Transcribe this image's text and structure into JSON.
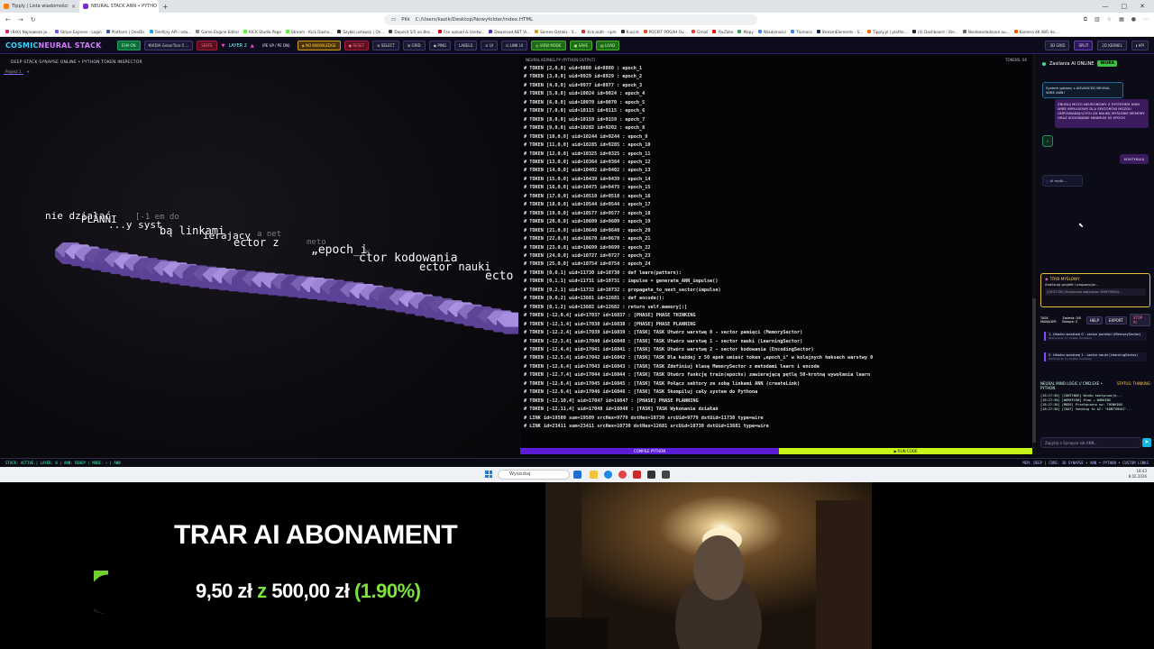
{
  "browser": {
    "tabs": [
      {
        "label": "Tipply | Lista wiadomości",
        "active": false
      },
      {
        "label": "NEURAL STACK ANN • PYTHO",
        "active": true
      }
    ],
    "new_tab": "+",
    "url_prefix": "Plik",
    "url": "C:/Users/kazik/Desktop/Nowyfolder/index.HTML",
    "bookmarks": [
      {
        "label": "(940) Najnowsze je...",
        "color": "#e0245e"
      },
      {
        "label": "Stripe Express - Login",
        "color": "#635bff"
      },
      {
        "label": "Platform | OneDis",
        "color": "#3b5998"
      },
      {
        "label": "Telefijny API i odu...",
        "color": "#1da1f2"
      },
      {
        "label": "Game Engine Editor",
        "color": "#888888"
      },
      {
        "label": "KICK Studio Page",
        "color": "#53fc18"
      },
      {
        "label": "Stream - Kick Dasho...",
        "color": "#53fc18"
      },
      {
        "label": "Szybki ustawcji | On...",
        "color": "#333333"
      },
      {
        "label": "Deposit 5/5 on Bec...",
        "color": "#444444"
      },
      {
        "label": "Fan upload & Usetw...",
        "color": "#d0021b"
      },
      {
        "label": "Download.NET Vi...",
        "color": "#512bd4"
      },
      {
        "label": "Serene Details - S...",
        "color": "#c9a227"
      },
      {
        "label": "tick-auth - npm",
        "color": "#cb3837"
      },
      {
        "label": "K-acint",
        "color": "#333333"
      },
      {
        "label": "POCKIT POGAH Ov...",
        "color": "#e94e1b"
      },
      {
        "label": "Gmail",
        "color": "#ea4335"
      },
      {
        "label": "YouTube",
        "color": "#ff0000"
      },
      {
        "label": "Mapy",
        "color": "#34a853"
      },
      {
        "label": "Wiadomości",
        "color": "#4285f4"
      },
      {
        "label": "Tłumacz",
        "color": "#4285f4"
      },
      {
        "label": "StreamElements - S...",
        "color": "#0f2c4c"
      },
      {
        "label": "Tipply.pl | platfor...",
        "color": "#ff6a00"
      },
      {
        "label": "(4) Dashboard - Ste...",
        "color": "#1b2838"
      },
      {
        "label": "Nienbandadzone au...",
        "color": "#666666"
      },
      {
        "label": "Kamera 4K WiFi do...",
        "color": "#ff5a00"
      }
    ]
  },
  "app": {
    "logo_part1": "COSMIC",
    "logo_part2": "NEURAL STACK",
    "header_buttons": [
      {
        "label": "ESM ON",
        "style": "g"
      },
      {
        "label": "NVIDIA GeaorTron-5 ...",
        "style": "d"
      },
      {
        "label": "SEKTE",
        "style": "r"
      }
    ],
    "layer_label": "LAYER 2",
    "layer_prev": "▼",
    "layer_next": "▲",
    "tool_buttons": [
      {
        "label": "(PE UP / PE DN)",
        "style": "t"
      },
      {
        "label": "◈ NO KNOWLEDGE",
        "style": "o"
      },
      {
        "label": "● RESET",
        "style": "r"
      },
      {
        "label": "⊕ SELECT",
        "style": "d"
      },
      {
        "label": "⊞ GRID",
        "style": "d"
      },
      {
        "label": "◉ PING",
        "style": "d"
      },
      {
        "label": "LABELS",
        "style": "d"
      },
      {
        "label": "⊘ UI",
        "style": "d"
      },
      {
        "label": "⊡ LINK UI",
        "style": "d"
      },
      {
        "label": "◎ VIEW MODE",
        "style": "grn"
      },
      {
        "label": "▣ SAVE",
        "style": "grn"
      },
      {
        "label": "▤ LOAD",
        "style": "grn"
      }
    ],
    "right_buttons": [
      {
        "label": "3D GRID",
        "style": "d"
      },
      {
        "label": "SPLIT",
        "style": "p"
      },
      {
        "label": "2D KERNEL",
        "style": "d"
      },
      {
        "label": "ℹ API",
        "style": "d"
      }
    ]
  },
  "left_pane": {
    "title": "DEEP STACK SYNAPSE ONLINE • PYTHON TOKEN INSPECTOR",
    "tab": "Project 1",
    "tab_add": "+",
    "floating_texts": [
      {
        "text": "nie działać",
        "color": "#ffffff"
      },
      {
        "text": "PLANNI",
        "color": "#ffffff"
      },
      {
        "text": "[-1 em do",
        "color": "#888888"
      },
      {
        "text": "...y syst",
        "color": "#ffffff"
      },
      {
        "text": "bą linkami",
        "color": "#ffffff"
      },
      {
        "text": "ierający",
        "color": "#ffffff"
      },
      {
        "text": "a net",
        "color": "#888888"
      },
      {
        "text": "ector z",
        "color": "#ffffff"
      },
      {
        "text": "meto",
        "color": "#777777"
      },
      {
        "text": "„epoch_i",
        "color": "#ffffff"
      },
      {
        "text": "w",
        "color": "#888888"
      },
      {
        "text": "ctor kodowania",
        "color": "#ffffff"
      },
      {
        "text": "ector nauki",
        "color": "#ffffff"
      },
      {
        "text": "ecto",
        "color": "#ffffff"
      }
    ]
  },
  "console": {
    "title": "NEURAL KERNEL.PY (PYTHON OUTPUT)",
    "count": "TOKENS: 66",
    "lines": [
      "# TOKEN [2,0,0] uid=9880 id=8880 : epoch_1",
      "# TOKEN [3,0,0] uid=9929 id=8929 : epoch_2",
      "# TOKEN [4,0,0] uid=9977 id=8977 : epoch_3",
      "# TOKEN [5,0,0] uid=10024 id=9024 : epoch_4",
      "# TOKEN [6,0,0] uid=10070 id=9070 : epoch_5",
      "# TOKEN [7,0,0] uid=10115 id=9115 : epoch_6",
      "# TOKEN [8,0,0] uid=10159 id=9159 : epoch_7",
      "# TOKEN [9,0,0] uid=10202 id=9202 : epoch_8",
      "# TOKEN [10,0,0] uid=10244 id=9244 : epoch_9",
      "# TOKEN [11,0,0] uid=10285 id=9285 : epoch_10",
      "# TOKEN [12,0,0] uid=10325 id=9325 : epoch_11",
      "# TOKEN [13,0,0] uid=10364 id=9364 : epoch_12",
      "# TOKEN [14,0,0] uid=10402 id=9402 : epoch_13",
      "# TOKEN [15,0,0] uid=10439 id=9439 : epoch_14",
      "# TOKEN [16,0,0] uid=10475 id=9475 : epoch_15",
      "# TOKEN [17,0,0] uid=10510 id=9510 : epoch_16",
      "# TOKEN [18,0,0] uid=10544 id=9544 : epoch_17",
      "# TOKEN [19,0,0] uid=10577 id=9577 : epoch_18",
      "# TOKEN [20,0,0] uid=10609 id=9609 : epoch_19",
      "# TOKEN [21,0,0] uid=10640 id=9640 : epoch_20",
      "# TOKEN [22,0,0] uid=10670 id=9670 : epoch_21",
      "# TOKEN [23,0,0] uid=10699 id=9699 : epoch_22",
      "# TOKEN [24,0,0] uid=10727 id=9727 : epoch_23",
      "# TOKEN [25,0,0] uid=10754 id=9754 : epoch_24",
      "# TOKEN [0,0,1] uid=11730 id=10730 : def learn(pattern):",
      "# TOKEN [0,1,1] uid=11731 id=10731 : impulse = generate_ANN_impulse()",
      "# TOKEN [0,2,1] uid=11732 id=10732 : propagate_to_next_sector(impulse)",
      "# TOKEN [0,0,2] uid=13681 id=12681 : def encode():",
      "# TOKEN [0,1,2] uid=13682 id=12682 : return self.memory[:]",
      "# TOKEN [-12,0,4] uid=17037 id=16037 : [PHASE] PHASE THINKING",
      "# TOKEN [-12,1,4] uid=17038 id=16038 : [PHASE] PHASE PLANNING",
      "# TOKEN [-12,2,4] uid=17039 id=16039 : [TASK] TASK Utwórz warstwę 0 - sector pamięci (MemorySector)",
      "# TOKEN [-12,3,4] uid=17040 id=16040 : [TASK] TASK Utwórz warstwę 1 - sector nauki (LearningSector)",
      "# TOKEN [-12,4,4] uid=17041 id=16041 : [TASK] TASK Utwórz warstwę 2 - sector kodowania (EncodingSector)",
      "# TOKEN [-12,5,4] uid=17042 id=16042 : [TASK] TASK Dla każdej z 50 epok umieść token „epoch_i\" w kolejnych heksach warstwy 0",
      "# TOKEN [-12,6,4] uid=17043 id=16043 : [TASK] TASK Zdefiniuj klasę MemorySector z metodami learn i encode",
      "# TOKEN [-12,7,4] uid=17044 id=16044 : [TASK] TASK Utwórz funkcję train(epochs) zawierającą pętlę 50-krotną wywołania learn",
      "# TOKEN [-12,8,4] uid=17045 id=16045 : [TASK] TASK Połącz sektory ze sobą linkami ANN (createLink)",
      "# TOKEN [-12,9,4] uid=17046 id=16046 : [TASK] TASK Skompiluj cały system do Pythona",
      "# TOKEN [-12,10,4] uid=17047 id=16047 : [PHASE] PHASE PLANNING",
      "# TOKEN [-12,11,4] uid=17048 id=16048 : [TASK] TASK Wykonanie działań",
      "# LINK id=19509 sum=19509 srcHex=9779 dstHex=10730 srcUid=9779 dstUid=11730 type=wire",
      "# LINK id=23411 sum=23411 srcHex=10730 dstHex=12681 srcUid=10730 dstUid=13681 type=wire"
    ],
    "compile_label": "COMPILE PYTHON",
    "run_label": "▶ RUN CODE"
  },
  "chat": {
    "title": "Zasilania AI ONLINE",
    "badge": "WORK",
    "bubble1": "System gotowy z ADVANCED NEURAL WIRE ANN!",
    "bubble2": "ZBUDUJ MÓZG NEURONOWY Z SYSTEMEM ANN! WIRE IMPULSOWY DLA SEKTORÓW MÓZGU ODPOWIADAJĄCYCH ZA NAUKĘ MYŚLENIE MEMORY ORAZ KODOWANIE MINIMUM 50 EPOCH",
    "check": "✓",
    "bubble3": "KONTYNUUJ",
    "thinking": "AI myśli...",
    "mode_title": "TRYB MYŚLOWY",
    "mode_subtitle": "Analizuję projekt i propozycje...",
    "mode_input": "[18:27:30] Otrzymano zapytanie: KONTYNUUJ...",
    "task_manager": "TASK MANAGER",
    "task_count": "Zadania: 0/8 Bieżące: 0",
    "help": "HELP",
    "export": "EXPORT",
    "stop": "STOP AI",
    "tasks": [
      {
        "text": "1. Utwórz warstwę 0 - sector pamięci (MemorySector)",
        "sub": "Ukończone: 0 / Czeka: Oczekuje"
      },
      {
        "text": "2. Utwórz warstwę 1 - sector nauki (LearningSector)",
        "sub": "Ukończone: 0 / Czeka: Oczekuje"
      }
    ],
    "neural_logic": "NEURAL MIND LOGIC // CMD.EXE • PYTHON",
    "status": "STATUS: THINKING",
    "log": [
      "[18:27:30] [CONTINUE] Wznów kontynuację...",
      "[18:27:30] [WORKFLOW] Etap → WORKING",
      "[18:27:30] [MODE] Przełączono na: THINKING",
      "[18:27:30] [CHAT] Sending to AI: \"KONTYNUUJ\"..."
    ],
    "input_placeholder": "Zapytaj o Synapse lub ANN...",
    "send": "➤"
  },
  "statusbar": {
    "left": "STACK: ACTIVE | LAYER: 0 | ANN: READY | MODE: ⚡ | ANN",
    "right": "MEM: DEEP | CORE: 3D SYNAPSE • ANN • PYTHON • CUSTOM LINKS"
  },
  "taskbar": {
    "search": "Wyszukaj",
    "time": "18:43",
    "date": "8.02.2026"
  },
  "overlay": {
    "title": "TRAR AI ABONAMENT",
    "amount": "9,50 zł",
    "sep": "z",
    "goal": "500,00 zł",
    "percent": "(1.90%)",
    "progress": 0.019
  }
}
